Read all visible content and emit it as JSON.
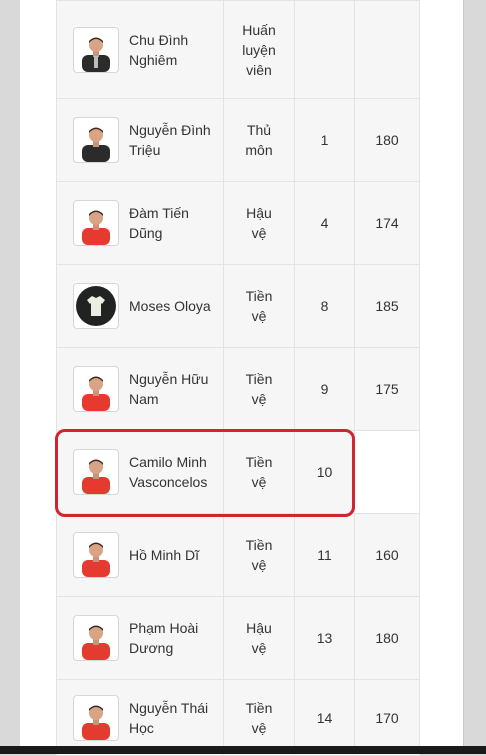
{
  "players": [
    {
      "name": "Chu Đình Nghiêm",
      "position": "Huấn luyện viên",
      "number": "",
      "height": "",
      "kit": "coach"
    },
    {
      "name": "Nguyễn Đình Triệu",
      "position": "Thủ môn",
      "number": "1",
      "height": "180",
      "kit": "black"
    },
    {
      "name": "Đàm Tiến Dũng",
      "position": "Hậu vệ",
      "number": "4",
      "height": "174",
      "kit": "red"
    },
    {
      "name": "Moses Oloya",
      "position": "Tiền vệ",
      "number": "8",
      "height": "185",
      "kit": "placeholder"
    },
    {
      "name": "Nguyễn Hữu Nam",
      "position": "Tiền vệ",
      "number": "9",
      "height": "175",
      "kit": "red"
    },
    {
      "name": "Camilo Minh Vasconcelos",
      "position": "Tiền vệ",
      "number": "10",
      "height": "",
      "kit": "red"
    },
    {
      "name": "Hồ Minh Dĩ",
      "position": "Tiền vệ",
      "number": "11",
      "height": "160",
      "kit": "red"
    },
    {
      "name": "Phạm Hoài Dương",
      "position": "Hậu vệ",
      "number": "13",
      "height": "180",
      "kit": "red"
    },
    {
      "name": "Nguyễn Thái Học",
      "position": "Tiền vệ",
      "number": "14",
      "height": "170",
      "kit": "red"
    }
  ],
  "highlighted_player": "Camilo Minh Vasconcelos",
  "colors": {
    "kit_red": "#e53a2f",
    "highlight_border": "#d1242f",
    "coach_kit": "#2b2b2b"
  }
}
